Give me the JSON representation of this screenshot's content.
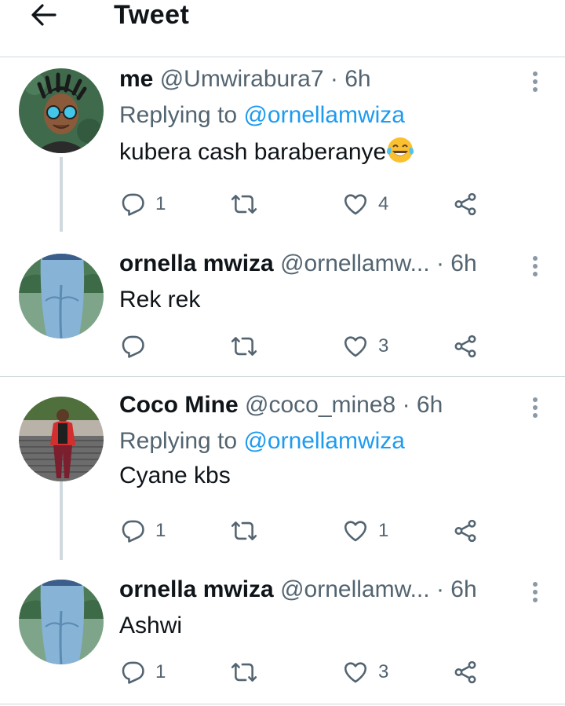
{
  "header": {
    "title": "Tweet",
    "back_icon": "arrow-left-icon"
  },
  "tweets": [
    {
      "name": "me",
      "handle": "@Umwirabura7",
      "dot": "·",
      "time": "6h",
      "replying_prefix": "Replying to ",
      "replying_to": "@ornellamwiza",
      "text": "kubera cash baraberanye",
      "emoji": "face-with-tears-of-joy-icon",
      "reply_count": "1",
      "retweet_count": "",
      "like_count": "4"
    },
    {
      "name": "ornella mwiza",
      "handle": "@ornellamw...",
      "dot": "·",
      "time": "6h",
      "text": "Rek rek",
      "reply_count": "",
      "retweet_count": "",
      "like_count": "3"
    },
    {
      "name": "Coco Mine",
      "handle": "@coco_mine8",
      "dot": "·",
      "time": "6h",
      "replying_prefix": "Replying to ",
      "replying_to": "@ornellamwiza",
      "text": "Cyane kbs",
      "reply_count": "1",
      "retweet_count": "",
      "like_count": "1"
    },
    {
      "name": "ornella mwiza",
      "handle": "@ornellamw...",
      "dot": "·",
      "time": "6h",
      "text": "Ashwi",
      "reply_count": "1",
      "retweet_count": "",
      "like_count": "3"
    }
  ],
  "colors": {
    "link": "#1d9bf0",
    "muted": "#536471",
    "divider": "#cfd9de",
    "text": "#0f1419"
  }
}
